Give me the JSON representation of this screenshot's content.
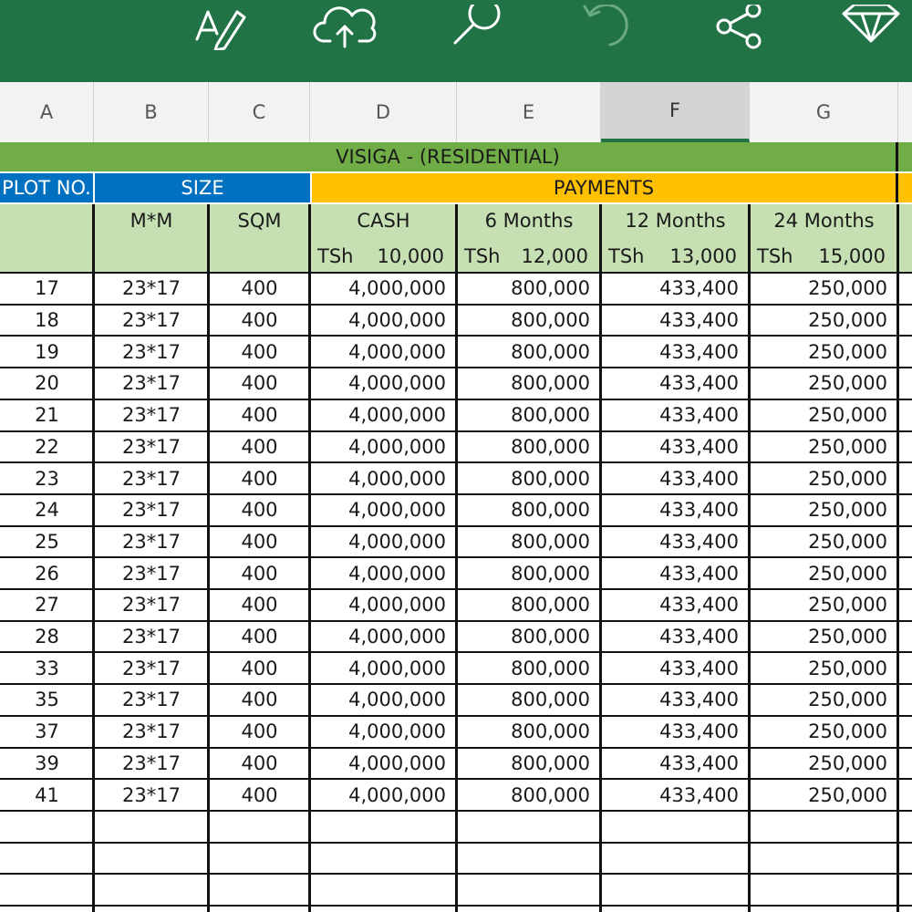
{
  "toolbar": {
    "background": "#217346",
    "icons": [
      "draw-pen-icon",
      "cloud-upload-icon",
      "search-icon",
      "undo-icon",
      "share-icon",
      "diamond-icon"
    ]
  },
  "columns": [
    "A",
    "B",
    "C",
    "D",
    "E",
    "F",
    "G"
  ],
  "selected_column": "F",
  "sheet": {
    "title": "VISIGA - (RESIDENTIAL)",
    "group_headers": {
      "plot": "PLOT NO.",
      "size": "SIZE",
      "payments": "PAYMENTS"
    },
    "sub_headers": {
      "mm": "M*M",
      "sqm": "SQM",
      "cash": {
        "label": "CASH",
        "currency": "TSh",
        "rate": "10,000"
      },
      "six": {
        "label": "6 Months",
        "currency": "TSh",
        "rate": "12,000"
      },
      "twelve": {
        "label": "12 Months",
        "currency": "TSh",
        "rate": "13,000"
      },
      "twentyfour": {
        "label": "24 Months",
        "currency": "TSh",
        "rate": "15,000"
      }
    },
    "rows": [
      {
        "plot": "17",
        "mm": "23*17",
        "sqm": "400",
        "cash": "4,000,000",
        "m6": "800,000",
        "m12": "433,400",
        "m24": "250,000"
      },
      {
        "plot": "18",
        "mm": "23*17",
        "sqm": "400",
        "cash": "4,000,000",
        "m6": "800,000",
        "m12": "433,400",
        "m24": "250,000"
      },
      {
        "plot": "19",
        "mm": "23*17",
        "sqm": "400",
        "cash": "4,000,000",
        "m6": "800,000",
        "m12": "433,400",
        "m24": "250,000"
      },
      {
        "plot": "20",
        "mm": "23*17",
        "sqm": "400",
        "cash": "4,000,000",
        "m6": "800,000",
        "m12": "433,400",
        "m24": "250,000"
      },
      {
        "plot": "21",
        "mm": "23*17",
        "sqm": "400",
        "cash": "4,000,000",
        "m6": "800,000",
        "m12": "433,400",
        "m24": "250,000"
      },
      {
        "plot": "22",
        "mm": "23*17",
        "sqm": "400",
        "cash": "4,000,000",
        "m6": "800,000",
        "m12": "433,400",
        "m24": "250,000"
      },
      {
        "plot": "23",
        "mm": "23*17",
        "sqm": "400",
        "cash": "4,000,000",
        "m6": "800,000",
        "m12": "433,400",
        "m24": "250,000"
      },
      {
        "plot": "24",
        "mm": "23*17",
        "sqm": "400",
        "cash": "4,000,000",
        "m6": "800,000",
        "m12": "433,400",
        "m24": "250,000"
      },
      {
        "plot": "25",
        "mm": "23*17",
        "sqm": "400",
        "cash": "4,000,000",
        "m6": "800,000",
        "m12": "433,400",
        "m24": "250,000"
      },
      {
        "plot": "26",
        "mm": "23*17",
        "sqm": "400",
        "cash": "4,000,000",
        "m6": "800,000",
        "m12": "433,400",
        "m24": "250,000"
      },
      {
        "plot": "27",
        "mm": "23*17",
        "sqm": "400",
        "cash": "4,000,000",
        "m6": "800,000",
        "m12": "433,400",
        "m24": "250,000"
      },
      {
        "plot": "28",
        "mm": "23*17",
        "sqm": "400",
        "cash": "4,000,000",
        "m6": "800,000",
        "m12": "433,400",
        "m24": "250,000"
      },
      {
        "plot": "33",
        "mm": "23*17",
        "sqm": "400",
        "cash": "4,000,000",
        "m6": "800,000",
        "m12": "433,400",
        "m24": "250,000"
      },
      {
        "plot": "35",
        "mm": "23*17",
        "sqm": "400",
        "cash": "4,000,000",
        "m6": "800,000",
        "m12": "433,400",
        "m24": "250,000"
      },
      {
        "plot": "37",
        "mm": "23*17",
        "sqm": "400",
        "cash": "4,000,000",
        "m6": "800,000",
        "m12": "433,400",
        "m24": "250,000"
      },
      {
        "plot": "39",
        "mm": "23*17",
        "sqm": "400",
        "cash": "4,000,000",
        "m6": "800,000",
        "m12": "433,400",
        "m24": "250,000"
      },
      {
        "plot": "41",
        "mm": "23*17",
        "sqm": "400",
        "cash": "4,000,000",
        "m6": "800,000",
        "m12": "433,400",
        "m24": "250,000"
      }
    ],
    "empty_rows": 3
  },
  "colors": {
    "title_band": "#70ad47",
    "plot_size_header": "#0070c0",
    "payments_header": "#ffc000",
    "subheader": "#c6e0b4"
  }
}
